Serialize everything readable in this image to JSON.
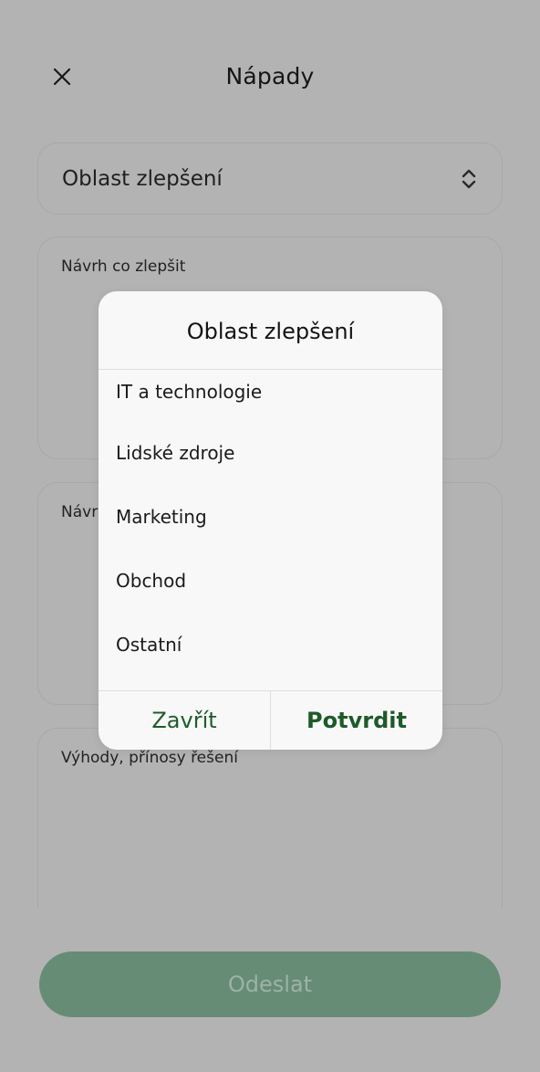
{
  "header": {
    "title": "Nápady"
  },
  "form": {
    "area_select_value": "Oblast zlepšení",
    "field1_label": "Návrh co zlepšit",
    "field2_label": "Návrh",
    "field3_label": "Výhody, přínosy řešení",
    "submit_label": "Odeslat"
  },
  "dialog": {
    "title": "Oblast zlepšení",
    "options": [
      "IT a technologie",
      "Lidské zdroje",
      "Marketing",
      "Obchod",
      "Ostatní"
    ],
    "cancel_label": "Zavřít",
    "confirm_label": "Potvrdit"
  },
  "colors": {
    "overlay_background": "#b3b3b3",
    "accent_green": "#1e5a28",
    "submit_button": "#678c75"
  },
  "icons": {
    "close": "close-icon",
    "select_chevron": "chevron-up-down-icon"
  }
}
